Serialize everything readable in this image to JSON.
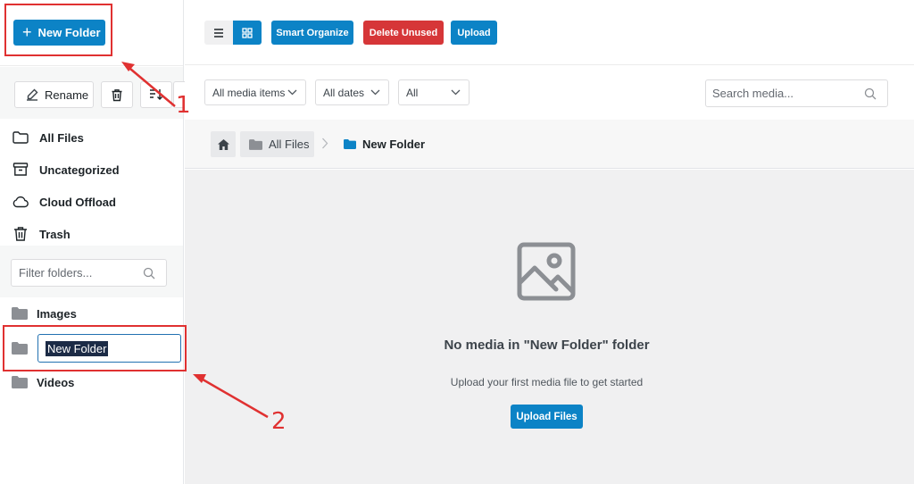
{
  "sidebar": {
    "new_folder_label": "New Folder",
    "rename_label": "Rename",
    "nav": [
      {
        "label": "All Files",
        "icon": "folder-outline-icon"
      },
      {
        "label": "Uncategorized",
        "icon": "archive-icon"
      },
      {
        "label": "Cloud Offload",
        "icon": "cloud-icon"
      },
      {
        "label": "Trash",
        "icon": "trash-icon"
      }
    ],
    "filter_placeholder": "Filter folders...",
    "folders": [
      {
        "label": "Images"
      },
      {
        "label": "New Folder",
        "editing": true
      },
      {
        "label": "Videos"
      }
    ]
  },
  "toolbar": {
    "smart_organize_label": "Smart Organize",
    "delete_unused_label": "Delete Unused",
    "upload_label": "Upload"
  },
  "filters": {
    "media_type": "All media items",
    "dates": "All dates",
    "all": "All",
    "search_placeholder": "Search media..."
  },
  "breadcrumb": {
    "root": "All Files",
    "current": "New Folder"
  },
  "empty_state": {
    "title": "No media in \"New Folder\" folder",
    "subtitle": "Upload your first media file to get started",
    "button": "Upload Files"
  },
  "annotations": {
    "one": "1",
    "two": "2"
  },
  "colors": {
    "primary": "#0c83c6",
    "danger": "#d63638",
    "annotation": "#e03131",
    "folder": "#8c8f94"
  }
}
